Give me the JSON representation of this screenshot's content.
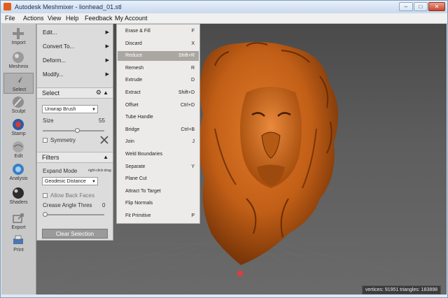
{
  "window": {
    "title": "Autodesk Meshmixer - lionhead_01.stl"
  },
  "menubar": [
    "File",
    "Actions",
    "View",
    "Help",
    "Feedback",
    "My Account"
  ],
  "toolbar": [
    {
      "label": "Import",
      "icon": "plus-icon"
    },
    {
      "label": "Meshmix",
      "icon": "sphere-icon"
    },
    {
      "label": "Select",
      "icon": "cursor-icon"
    },
    {
      "label": "Sculpt",
      "icon": "brush-icon"
    },
    {
      "label": "Stamp",
      "icon": "stamp-icon"
    },
    {
      "label": "Edit",
      "icon": "edit-sphere-icon"
    },
    {
      "label": "Analysis",
      "icon": "analysis-icon"
    },
    {
      "label": "Shaders",
      "icon": "shader-ball-icon"
    },
    {
      "label": "Export",
      "icon": "export-icon"
    },
    {
      "label": "Print",
      "icon": "print-icon"
    }
  ],
  "panel": {
    "menu": [
      {
        "label": "Edit..."
      },
      {
        "label": "Convert To..."
      },
      {
        "label": "Deform..."
      },
      {
        "label": "Modify..."
      }
    ],
    "select_section": {
      "title": "Select",
      "brush": "Unwrap Brush",
      "size_label": "Size",
      "size_value": "55",
      "size_fraction": 0.55,
      "symmetry_label": "Symmetry"
    },
    "filters_section": {
      "title": "Filters",
      "expand_mode_label": "Expand Mode",
      "expand_mode_hint": "right-click-drag",
      "expand_mode_value": "Geodesic Distance",
      "allow_back_faces_label": "Allow Back Faces",
      "crease_label": "Crease Angle Thres",
      "crease_value": "0",
      "crease_fraction": 0
    },
    "clear_button": "Clear Selection"
  },
  "edit_submenu": [
    {
      "label": "Erase & Fill",
      "shortcut": "F"
    },
    {
      "label": "Discard",
      "shortcut": "X"
    },
    {
      "label": "Reduce",
      "shortcut": "Shift+R",
      "highlighted": true
    },
    {
      "label": "Remesh",
      "shortcut": "R"
    },
    {
      "label": "Extrude",
      "shortcut": "D"
    },
    {
      "label": "Extract",
      "shortcut": "Shift+D"
    },
    {
      "label": "Offset",
      "shortcut": "Ctrl+D"
    },
    {
      "label": "Tube Handle",
      "shortcut": ""
    },
    {
      "label": "Bridge",
      "shortcut": "Ctrl+B"
    },
    {
      "label": "Join",
      "shortcut": "J"
    },
    {
      "label": "Weld Boundaries",
      "shortcut": ""
    },
    {
      "label": "Separate",
      "shortcut": "Y"
    },
    {
      "label": "Plane Cut",
      "shortcut": ""
    },
    {
      "label": "Attract To Target",
      "shortcut": ""
    },
    {
      "label": "Flip Normals",
      "shortcut": ""
    },
    {
      "label": "Fit Primitive",
      "shortcut": "P"
    }
  ],
  "status": "vertices: 91951 triangles: 183898",
  "colors": {
    "model": "#c8661e",
    "highlight": "#aaa7a3",
    "viewport": "#555555"
  }
}
